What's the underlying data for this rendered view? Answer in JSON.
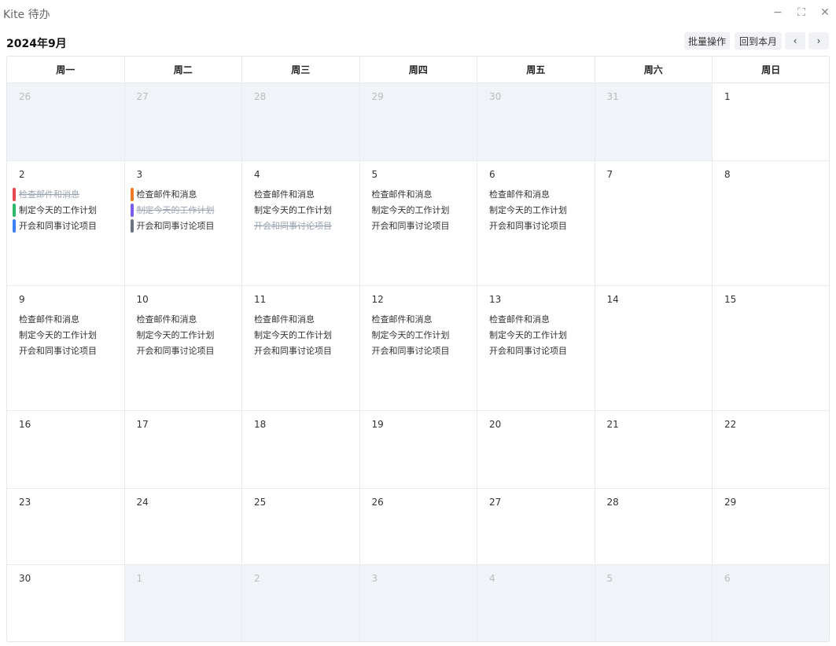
{
  "app": {
    "title": "Kite 待办",
    "min_icon": "−",
    "max_icon": "⛶",
    "close_icon": "✕"
  },
  "toolbar": {
    "month_title": "2024年9月",
    "batch_label": "批量操作",
    "today_label": "回到本月",
    "prev_label": "‹",
    "next_label": "›"
  },
  "weekdays": [
    "周一",
    "周二",
    "周三",
    "周四",
    "周五",
    "周六",
    "周日"
  ],
  "rows": [
    [
      {
        "d": "26",
        "o": true
      },
      {
        "d": "27",
        "o": true
      },
      {
        "d": "28",
        "o": true
      },
      {
        "d": "29",
        "o": true
      },
      {
        "d": "30",
        "o": true
      },
      {
        "d": "31",
        "o": true
      },
      {
        "d": "1",
        "o": false
      }
    ],
    [
      {
        "d": "2",
        "o": false,
        "tasks": [
          {
            "t": "检查邮件和消息",
            "done": true,
            "c": "#e5484d"
          },
          {
            "t": "制定今天的工作计划",
            "done": false,
            "c": "#2fb86a"
          },
          {
            "t": "开会和同事讨论项目",
            "done": false,
            "c": "#3b82f6"
          }
        ]
      },
      {
        "d": "3",
        "o": false,
        "tasks": [
          {
            "t": "检查邮件和消息",
            "done": false,
            "c": "#f07a1f"
          },
          {
            "t": "制定今天的工作计划",
            "done": true,
            "c": "#7c5cf0"
          },
          {
            "t": "开会和同事讨论项目",
            "done": false,
            "c": "#6b7280"
          }
        ]
      },
      {
        "d": "4",
        "o": false,
        "tasks": [
          {
            "t": "检查邮件和消息",
            "done": false
          },
          {
            "t": "制定今天的工作计划",
            "done": false
          },
          {
            "t": "开会和同事讨论项目",
            "done": true
          }
        ]
      },
      {
        "d": "5",
        "o": false,
        "tasks": [
          {
            "t": "检查邮件和消息",
            "done": false
          },
          {
            "t": "制定今天的工作计划",
            "done": false
          },
          {
            "t": "开会和同事讨论项目",
            "done": false
          }
        ]
      },
      {
        "d": "6",
        "o": false,
        "tasks": [
          {
            "t": "检查邮件和消息",
            "done": false
          },
          {
            "t": "制定今天的工作计划",
            "done": false
          },
          {
            "t": "开会和同事讨论项目",
            "done": false
          }
        ]
      },
      {
        "d": "7",
        "o": false
      },
      {
        "d": "8",
        "o": false
      }
    ],
    [
      {
        "d": "9",
        "o": false,
        "tasks": [
          {
            "t": "检查邮件和消息",
            "done": false
          },
          {
            "t": "制定今天的工作计划",
            "done": false
          },
          {
            "t": "开会和同事讨论项目",
            "done": false
          }
        ]
      },
      {
        "d": "10",
        "o": false,
        "tasks": [
          {
            "t": "检查邮件和消息",
            "done": false
          },
          {
            "t": "制定今天的工作计划",
            "done": false
          },
          {
            "t": "开会和同事讨论项目",
            "done": false
          }
        ]
      },
      {
        "d": "11",
        "o": false,
        "tasks": [
          {
            "t": "检查邮件和消息",
            "done": false
          },
          {
            "t": "制定今天的工作计划",
            "done": false
          },
          {
            "t": "开会和同事讨论项目",
            "done": false
          }
        ]
      },
      {
        "d": "12",
        "o": false,
        "tasks": [
          {
            "t": "检查邮件和消息",
            "done": false
          },
          {
            "t": "制定今天的工作计划",
            "done": false
          },
          {
            "t": "开会和同事讨论项目",
            "done": false
          }
        ]
      },
      {
        "d": "13",
        "o": false,
        "tasks": [
          {
            "t": "检查邮件和消息",
            "done": false
          },
          {
            "t": "制定今天的工作计划",
            "done": false
          },
          {
            "t": "开会和同事讨论项目",
            "done": false
          }
        ]
      },
      {
        "d": "14",
        "o": false
      },
      {
        "d": "15",
        "o": false
      }
    ],
    [
      {
        "d": "16",
        "o": false
      },
      {
        "d": "17",
        "o": false
      },
      {
        "d": "18",
        "o": false
      },
      {
        "d": "19",
        "o": false
      },
      {
        "d": "20",
        "o": false
      },
      {
        "d": "21",
        "o": false
      },
      {
        "d": "22",
        "o": false
      }
    ],
    [
      {
        "d": "23",
        "o": false
      },
      {
        "d": "24",
        "o": false
      },
      {
        "d": "25",
        "o": false
      },
      {
        "d": "26",
        "o": false
      },
      {
        "d": "27",
        "o": false
      },
      {
        "d": "28",
        "o": false
      },
      {
        "d": "29",
        "o": false
      }
    ],
    [
      {
        "d": "30",
        "o": false
      },
      {
        "d": "1",
        "o": true
      },
      {
        "d": "2",
        "o": true
      },
      {
        "d": "3",
        "o": true
      },
      {
        "d": "4",
        "o": true
      },
      {
        "d": "5",
        "o": true
      },
      {
        "d": "6",
        "o": true
      }
    ]
  ]
}
